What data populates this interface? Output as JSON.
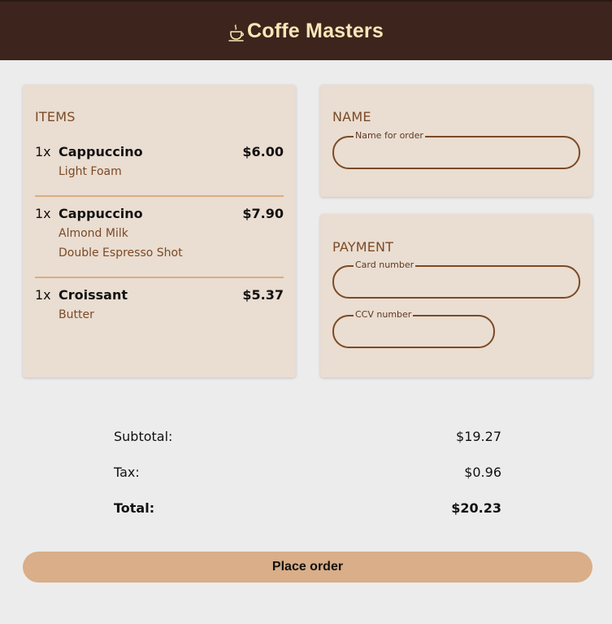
{
  "header": {
    "title": "Coffe Masters",
    "logo_icon": "coffee-cup-icon",
    "bg_color": "#3d241c",
    "title_color": "#fbe6b8"
  },
  "items": {
    "heading": "ITEMS",
    "line_items": [
      {
        "qty": "1x",
        "name": "Cappuccino",
        "price": "$6.00",
        "options": [
          "Light Foam"
        ]
      },
      {
        "qty": "1x",
        "name": "Cappuccino",
        "price": "$7.90",
        "options": [
          "Almond Milk",
          "Double Espresso Shot"
        ]
      },
      {
        "qty": "1x",
        "name": "Croissant",
        "price": "$5.37",
        "options": [
          "Butter"
        ]
      }
    ]
  },
  "name_section": {
    "heading": "NAME",
    "name_field": {
      "label": "Name for order",
      "value": ""
    }
  },
  "payment": {
    "heading": "PAYMENT",
    "card_field": {
      "label": "Card number",
      "value": ""
    },
    "ccv_field": {
      "label": "CCV number",
      "value": ""
    }
  },
  "totals": {
    "subtotal_label": "Subtotal:",
    "subtotal_value": "$19.27",
    "tax_label": "Tax:",
    "tax_value": "$0.96",
    "total_label": "Total:",
    "total_value": "$20.23"
  },
  "place_order": {
    "label": "Place order",
    "color": "#d9ae88"
  }
}
